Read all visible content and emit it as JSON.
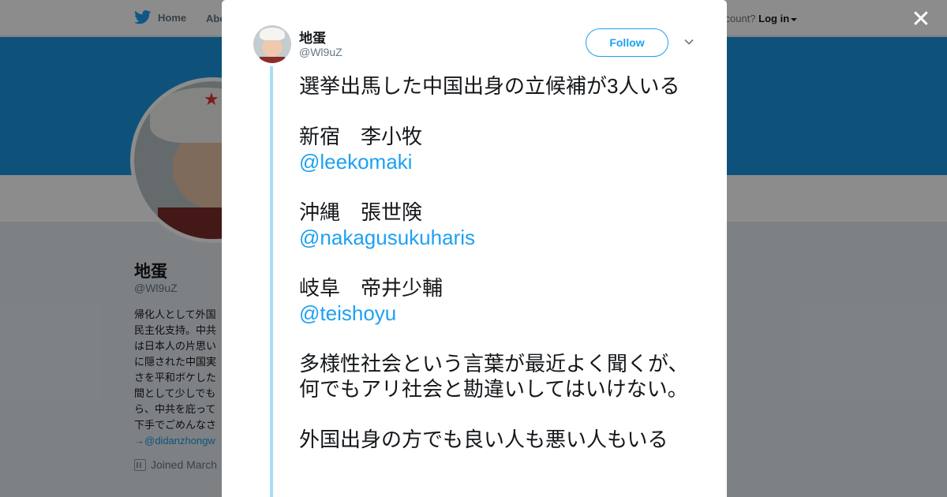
{
  "background_page": {
    "nav": {
      "home_label": "Home",
      "about_label": "Abo",
      "account_prompt": "ccount?",
      "login_label": "Log in"
    },
    "profile": {
      "name": "地蛋",
      "handle": "@Wl9uZ",
      "bio_lines": [
        "帰化人として外国",
        "民主化支持。中共",
        "は日本人の片思い",
        "に隠された中国実",
        "さを平和ボケした",
        "間として少しでも",
        "ら、中共を庇って",
        "下手でごめんなさ"
      ],
      "bio_link": "→@didanzhongw",
      "joined": "Joined March"
    }
  },
  "modal": {
    "user": {
      "name": "地蛋",
      "handle": "@Wl9uZ"
    },
    "follow_label": "Follow",
    "close_symbol": "✕",
    "tweet": {
      "intro": "選挙出馬した中国出身の立候補が3人いる",
      "candidates": [
        {
          "label": "新宿　李小牧",
          "mention": "@leekomaki"
        },
        {
          "label": "沖縄　張世険",
          "mention": "@nakagusukuharis"
        },
        {
          "label": "岐阜　帝井少輔",
          "mention": "@teishoyu"
        }
      ],
      "paragraph": "多様性社会という言葉が最近よく聞くが、何でもアリ社会と勘違いしてはいけない。",
      "last_line": "外国出身の方でも良い人も悪い人もいる"
    }
  },
  "colors": {
    "brand_blue": "#1da1f2",
    "banner_blue": "#1b95e0",
    "thread_line": "#a9dcf5"
  }
}
